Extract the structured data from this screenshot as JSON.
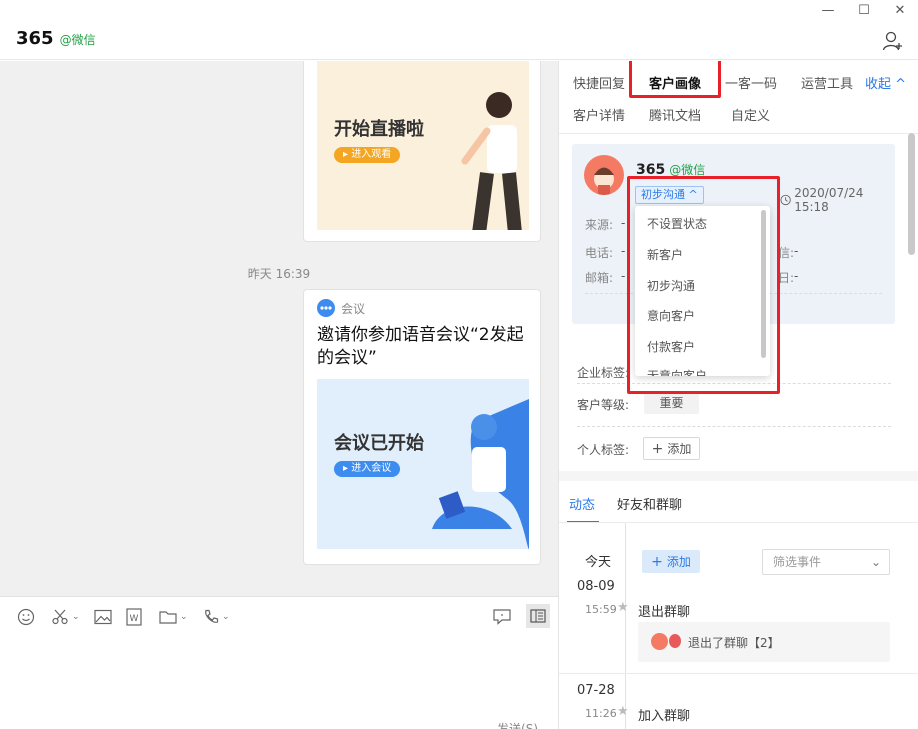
{
  "window": {
    "minimize": "—",
    "maximize": "☐",
    "close": "✕"
  },
  "chat": {
    "title": "365",
    "tag": "@微信",
    "messages": [
      {
        "type": "live-card",
        "poster_title": "开始直播啦",
        "poster_button": "进入观看"
      },
      {
        "type": "timestamp",
        "text": "昨天 16:39"
      },
      {
        "type": "meeting-card",
        "source": "会议",
        "text": "邀请你参加语音会议“2发起的会议”",
        "poster_title": "会议已开始",
        "poster_button": "进入会议"
      }
    ],
    "send_label": "发送(S)"
  },
  "panel": {
    "tabs": [
      "快捷回复",
      "客户画像",
      "一客一码",
      "运营工具"
    ],
    "tabs2": [
      "客户详情",
      "腾讯文档",
      "自定义"
    ],
    "collapse_label": "收起 ^",
    "active_tab": "客户画像",
    "profile": {
      "name": "365",
      "tag": "@微信",
      "status": "初步沟通 ^",
      "date": "2020/07/24 15:18",
      "fields": [
        {
          "label": "来源:",
          "value": "-"
        },
        {
          "label": "电话:",
          "value": "-"
        },
        {
          "label": "邮箱:",
          "value": "-"
        }
      ],
      "right_values": [
        "-",
        "-"
      ],
      "right_labels": [
        "信:",
        "日:"
      ]
    },
    "status_options": [
      "不设置状态",
      "新客户",
      "初步沟通",
      "意向客户",
      "付款客户",
      "无意向客户"
    ],
    "enterprise_tag_label": "企业标签:",
    "level_label": "客户等级:",
    "level_value": "重要",
    "personal_tag_label": "个人标签:",
    "add_label": "添加",
    "sub_tabs": [
      "动态",
      "好友和群聊"
    ],
    "timeline": {
      "today_label": "今天",
      "add_label": "添加",
      "filter_placeholder": "筛选事件",
      "entries": [
        {
          "date": "08-09",
          "time": "15:59",
          "event": "退出群聊",
          "detail": "退出了群聊【2】"
        },
        {
          "date": "07-28",
          "time": "11:26",
          "event": "加入群聊"
        }
      ]
    }
  },
  "colors": {
    "accent": "#2b7ae8",
    "wechat_green": "#22a047",
    "highlight": "#e8202a"
  }
}
